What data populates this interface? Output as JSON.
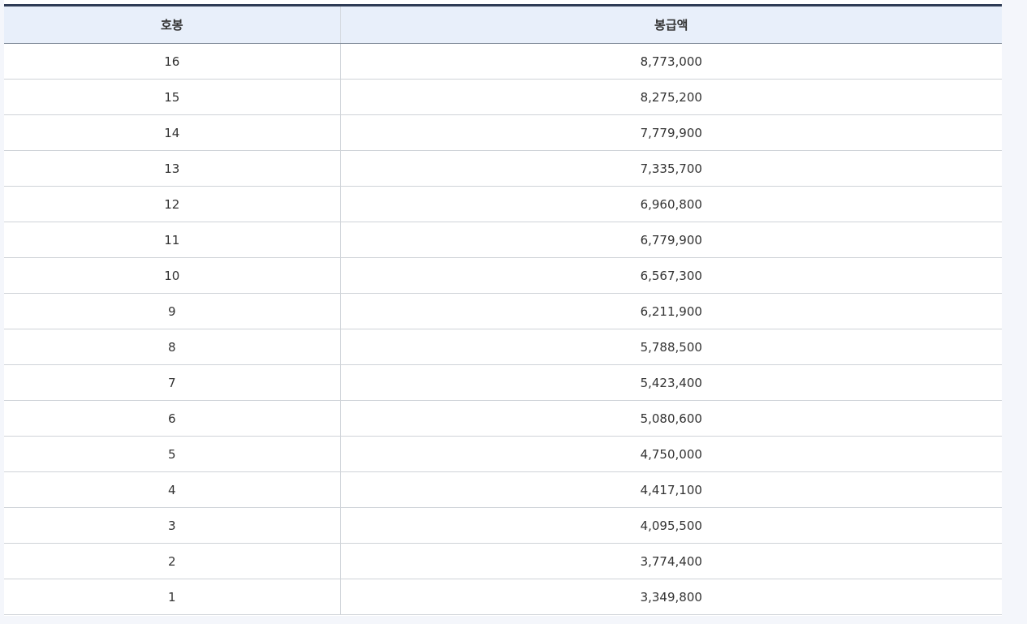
{
  "table": {
    "headers": [
      "호봉",
      "봉급액"
    ],
    "rows": [
      {
        "step": "16",
        "amount": "8,773,000"
      },
      {
        "step": "15",
        "amount": "8,275,200"
      },
      {
        "step": "14",
        "amount": "7,779,900"
      },
      {
        "step": "13",
        "amount": "7,335,700"
      },
      {
        "step": "12",
        "amount": "6,960,800"
      },
      {
        "step": "11",
        "amount": "6,779,900"
      },
      {
        "step": "10",
        "amount": "6,567,300"
      },
      {
        "step": "9",
        "amount": "6,211,900"
      },
      {
        "step": "8",
        "amount": "5,788,500"
      },
      {
        "step": "7",
        "amount": "5,423,400"
      },
      {
        "step": "6",
        "amount": "5,080,600"
      },
      {
        "step": "5",
        "amount": "4,750,000"
      },
      {
        "step": "4",
        "amount": "4,417,100"
      },
      {
        "step": "3",
        "amount": "4,095,500"
      },
      {
        "step": "2",
        "amount": "3,774,400"
      },
      {
        "step": "1",
        "amount": "3,349,800"
      }
    ]
  },
  "colors": {
    "header_bg": "#e8effa",
    "top_border": "#2e3b55",
    "page_bg": "#f4f6fb"
  }
}
